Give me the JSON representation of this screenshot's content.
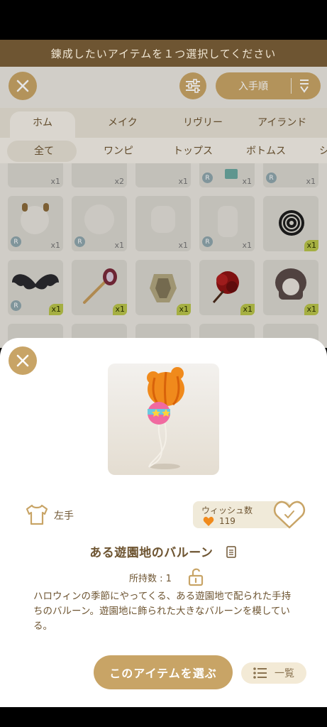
{
  "header": {
    "banner_text": "錬成したいアイテムを１つ選択してください",
    "sort_label": "入手順"
  },
  "category_tabs": [
    {
      "label": "ホム",
      "active": true
    },
    {
      "label": "メイク",
      "active": false
    },
    {
      "label": "リヴリー",
      "active": false
    },
    {
      "label": "アイランド",
      "active": false
    }
  ],
  "sub_tabs": [
    {
      "label": "全て",
      "active": true
    },
    {
      "label": "ワンピ",
      "active": false
    },
    {
      "label": "トップス",
      "active": false
    },
    {
      "label": "ボトムス",
      "active": false
    },
    {
      "label": "シ",
      "active": false
    }
  ],
  "grid": {
    "row1": [
      "x1",
      "x2",
      "x1",
      "x1",
      "x1"
    ],
    "row2": [
      "x1",
      "x1",
      "x1",
      "x1",
      "x1"
    ],
    "row3": [
      "x1",
      "x1",
      "x1",
      "x1",
      "x1"
    ],
    "badge_letter": "R"
  },
  "detail": {
    "slot_label": "左手",
    "wish_label": "ウィッシュ数",
    "wish_count": "119",
    "item_name": "ある遊園地のバルーン",
    "owned_text": "所持数 : 1",
    "description": "ハロウィンの季節にやってくる、ある遊園地で配られた手持ちのバルーン。遊園地に飾られた大きなバルーンを模している。",
    "choose_label": "このアイテムを選ぶ",
    "list_label": "一覧"
  },
  "colors": {
    "brand_gold": "#c8a466",
    "brown_text": "#6e5532",
    "banner_bg": "#6e5532",
    "badge_green": "#b8c34a"
  },
  "icons": [
    "close-icon",
    "filter-sliders-icon",
    "sort-order-icon",
    "shirt-icon",
    "heart-icon",
    "heart-check-icon",
    "copy-icon",
    "padlock-open-icon",
    "list-icon",
    "balloon-item-image"
  ]
}
